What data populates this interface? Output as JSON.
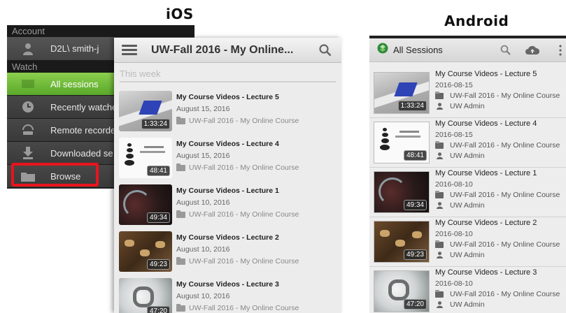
{
  "headings": {
    "ios": "iOS",
    "android": "Android"
  },
  "ios_drawer": {
    "account_section": "Account",
    "user": "D2L\\ smith-j",
    "watch_section": "Watch",
    "items": [
      {
        "label": "All sessions",
        "icon": "video-icon"
      },
      {
        "label": "Recently watche",
        "icon": "clock-icon"
      },
      {
        "label": "Remote recorde",
        "icon": "remote-recorder-icon"
      },
      {
        "label": "Downloaded se",
        "icon": "download-icon"
      },
      {
        "label": "Browse",
        "icon": "folder-icon"
      }
    ],
    "highlight_color": "#e8141c",
    "active_color": "#6fbe3a"
  },
  "ios_main": {
    "title": "UW-Fall 2016 - My Online...",
    "section": "This week",
    "items": [
      {
        "title": "My Course Videos - Lecture 5",
        "date": "August 15, 2016",
        "folder": "UW-Fall 2016 - My Online Course",
        "duration": "1:33:24"
      },
      {
        "title": "My Course Videos - Lecture 4",
        "date": "August 15, 2016",
        "folder": "UW-Fall 2016 - My Online Course",
        "duration": "48:41"
      },
      {
        "title": "My Course Videos - Lecture 1",
        "date": "August 10, 2016",
        "folder": "UW-Fall 2016 - My Online Course",
        "duration": "49:34"
      },
      {
        "title": "My Course Videos - Lecture 2",
        "date": "August 10, 2016",
        "folder": "UW-Fall 2016 - My Online Course",
        "duration": "49:23"
      },
      {
        "title": "My Course Videos - Lecture 3",
        "date": "August 10, 2016",
        "folder": "UW-Fall 2016 - My Online Course",
        "duration": "47:20"
      }
    ]
  },
  "android": {
    "title": "All Sessions",
    "items": [
      {
        "title": "My Course Videos - Lecture 5",
        "date": "2016-08-15",
        "folder": "UW-Fall 2016 - My Online Course",
        "owner": "UW Admin",
        "duration": "1:33:24"
      },
      {
        "title": "My Course Videos - Lecture 4",
        "date": "2016-08-15",
        "folder": "UW-Fall 2016 - My Online Course",
        "owner": "UW Admin",
        "duration": "48:41"
      },
      {
        "title": "My Course Videos - Lecture 1",
        "date": "2016-08-10",
        "folder": "UW-Fall 2016 - My Online Course",
        "owner": "UW Admin",
        "duration": "49:34"
      },
      {
        "title": "My Course Videos - Lecture 2",
        "date": "2016-08-10",
        "folder": "UW-Fall 2016 - My Online Course",
        "owner": "UW Admin",
        "duration": "49:23"
      },
      {
        "title": "My Course Videos - Lecture 3",
        "date": "2016-08-10",
        "folder": "UW-Fall 2016 - My Online Course",
        "owner": "UW Admin",
        "duration": "47:20"
      }
    ]
  }
}
